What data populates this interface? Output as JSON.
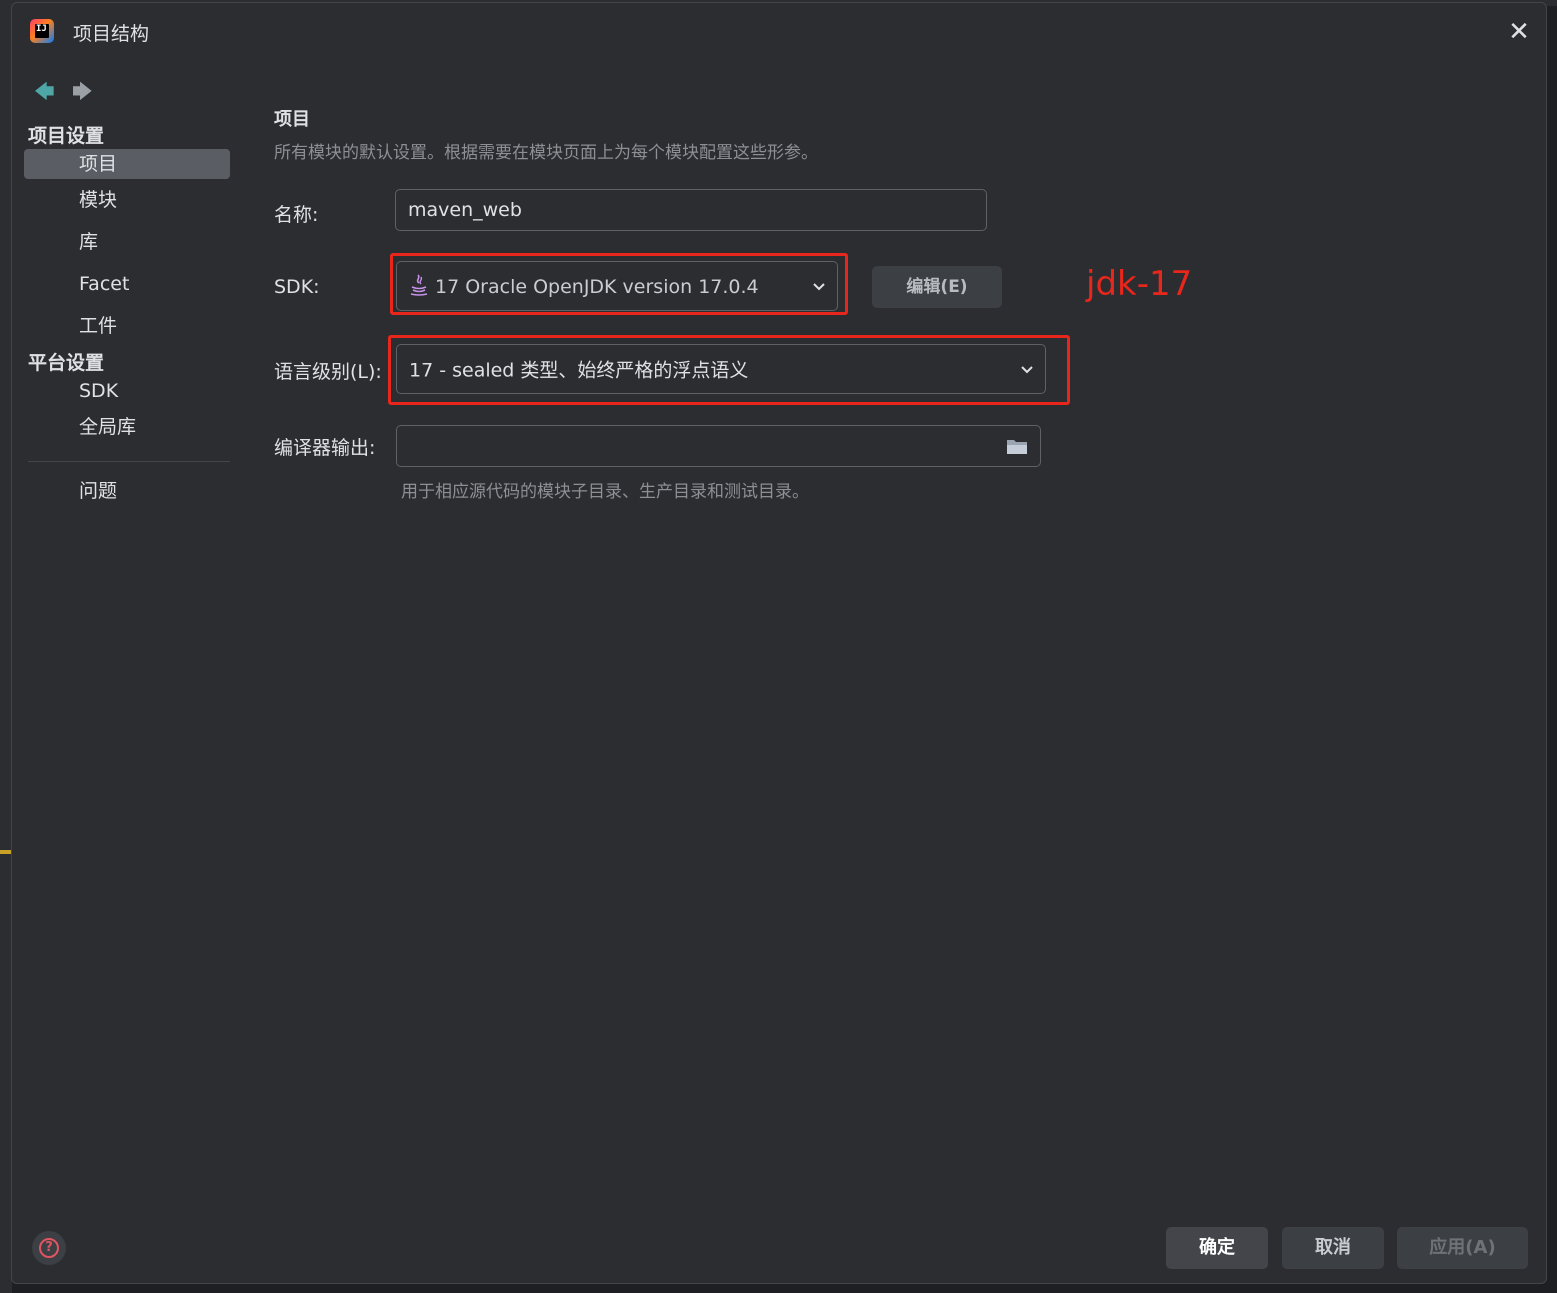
{
  "window": {
    "title": "项目结构"
  },
  "sidebar": {
    "project_settings": {
      "title": "项目设置",
      "items": [
        "项目",
        "模块",
        "库",
        "Facet",
        "工件"
      ]
    },
    "platform_settings": {
      "title": "平台设置",
      "items": [
        "SDK",
        "全局库"
      ]
    },
    "problems": "问题"
  },
  "main": {
    "section_title": "项目",
    "section_desc": "所有模块的默认设置。根据需要在模块页面上为每个模块配置这些形参。",
    "name": {
      "label": "名称:",
      "value": "maven_web"
    },
    "sdk": {
      "label": "SDK:",
      "value": "17 Oracle OpenJDK version 17.0.4",
      "edit_button": "编辑(E)"
    },
    "language_level": {
      "label": "语言级别(L):",
      "value": "17 - sealed 类型、始终严格的浮点语义"
    },
    "compiler_output": {
      "label": "编译器输出:",
      "value": "",
      "hint": "用于相应源代码的模块子目录、生产目录和测试目录。"
    },
    "annotation": "jdk-17"
  },
  "footer": {
    "ok": "确定",
    "cancel": "取消",
    "apply": "应用(A)"
  },
  "colors": {
    "highlight": "#e8261c",
    "background": "#2b2d30",
    "selected": "#5a5d63"
  }
}
